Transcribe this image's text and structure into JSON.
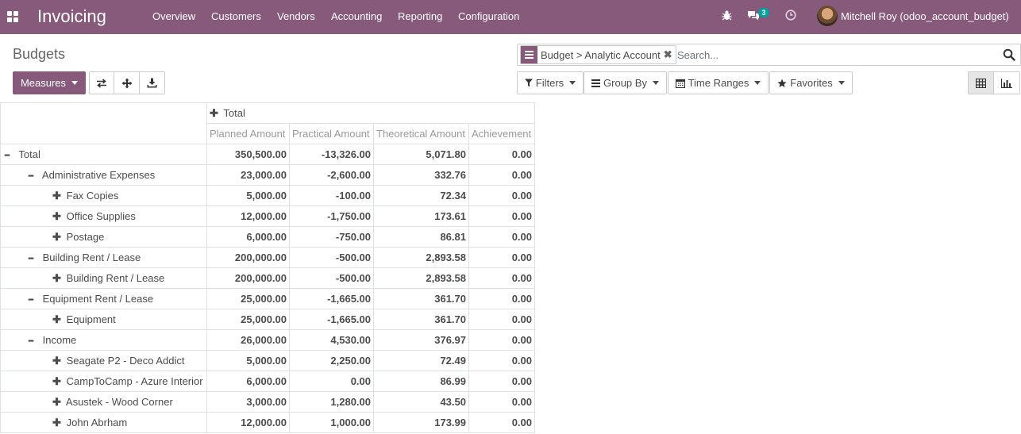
{
  "navbar": {
    "app_name": "Invoicing",
    "menu": [
      "Overview",
      "Customers",
      "Vendors",
      "Accounting",
      "Reporting",
      "Configuration"
    ],
    "chat_count": "3",
    "user": "Mitchell Roy (odoo_account_budget)"
  },
  "page": {
    "title": "Budgets"
  },
  "search": {
    "facet": "Budget > Analytic Account",
    "placeholder": "Search..."
  },
  "toolbar": {
    "measures": "Measures",
    "filters": "Filters",
    "group_by": "Group By",
    "time_ranges": "Time Ranges",
    "favorites": "Favorites"
  },
  "pivot": {
    "col_header": "Total",
    "measures": [
      "Planned Amount",
      "Practical Amount",
      "Theoretical Amount",
      "Achievement"
    ],
    "rows": [
      {
        "label": "Total",
        "level": 0,
        "expanded": true,
        "values": [
          "350,500.00",
          "-13,326.00",
          "5,071.80",
          "0.00"
        ]
      },
      {
        "label": "Administrative Expenses",
        "level": 1,
        "expanded": true,
        "values": [
          "23,000.00",
          "-2,600.00",
          "332.76",
          "0.00"
        ]
      },
      {
        "label": "Fax Copies",
        "level": 2,
        "expanded": false,
        "values": [
          "5,000.00",
          "-100.00",
          "72.34",
          "0.00"
        ]
      },
      {
        "label": "Office Supplies",
        "level": 2,
        "expanded": false,
        "values": [
          "12,000.00",
          "-1,750.00",
          "173.61",
          "0.00"
        ]
      },
      {
        "label": "Postage",
        "level": 2,
        "expanded": false,
        "values": [
          "6,000.00",
          "-750.00",
          "86.81",
          "0.00"
        ]
      },
      {
        "label": "Building Rent / Lease",
        "level": 1,
        "expanded": true,
        "values": [
          "200,000.00",
          "-500.00",
          "2,893.58",
          "0.00"
        ]
      },
      {
        "label": "Building Rent / Lease",
        "level": 2,
        "expanded": false,
        "values": [
          "200,000.00",
          "-500.00",
          "2,893.58",
          "0.00"
        ]
      },
      {
        "label": "Equipment Rent / Lease",
        "level": 1,
        "expanded": true,
        "values": [
          "25,000.00",
          "-1,665.00",
          "361.70",
          "0.00"
        ]
      },
      {
        "label": "Equipment",
        "level": 2,
        "expanded": false,
        "values": [
          "25,000.00",
          "-1,665.00",
          "361.70",
          "0.00"
        ]
      },
      {
        "label": "Income",
        "level": 1,
        "expanded": true,
        "values": [
          "26,000.00",
          "4,530.00",
          "376.97",
          "0.00"
        ]
      },
      {
        "label": "Seagate P2 - Deco Addict",
        "level": 2,
        "expanded": false,
        "values": [
          "5,000.00",
          "2,250.00",
          "72.49",
          "0.00"
        ]
      },
      {
        "label": "CampToCamp - Azure Interior",
        "level": 2,
        "expanded": false,
        "values": [
          "6,000.00",
          "0.00",
          "86.99",
          "0.00"
        ]
      },
      {
        "label": "Asustek - Wood Corner",
        "level": 2,
        "expanded": false,
        "values": [
          "3,000.00",
          "1,280.00",
          "43.50",
          "0.00"
        ]
      },
      {
        "label": "John Abrham",
        "level": 2,
        "expanded": false,
        "values": [
          "12,000.00",
          "1,000.00",
          "173.99",
          "0.00"
        ]
      }
    ]
  },
  "colors": {
    "brand": "#875a7b",
    "badge": "#00a09d"
  }
}
